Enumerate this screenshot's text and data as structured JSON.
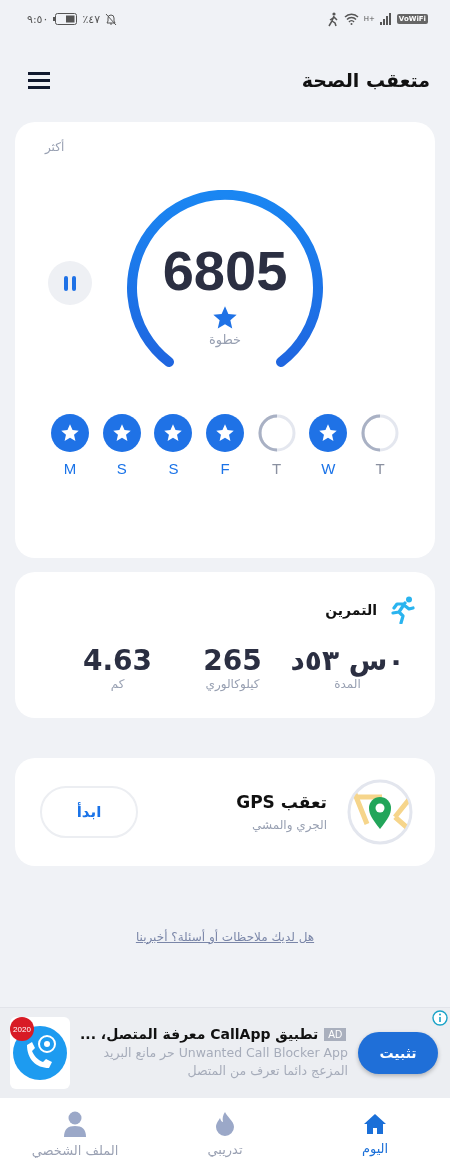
{
  "status_bar": {
    "time": "٩:٥٠",
    "battery": "٪٤٧",
    "network": "H+",
    "wifi_badge": "VoWiFi"
  },
  "header": {
    "title": "متعقب الصحة"
  },
  "steps_card": {
    "more": "أكثر",
    "steps": "6805",
    "unit": "خطوة",
    "days": [
      {
        "label": "T",
        "done": false
      },
      {
        "label": "W",
        "done": true
      },
      {
        "label": "T",
        "done": false
      },
      {
        "label": "F",
        "done": true
      },
      {
        "label": "S",
        "done": true
      },
      {
        "label": "S",
        "done": true
      },
      {
        "label": "M",
        "done": true
      }
    ]
  },
  "workout_card": {
    "title": "التمرين",
    "stats": [
      {
        "value": "٠س ٥٣د",
        "label": "المدة"
      },
      {
        "value": "265",
        "label": "كيلوكالوري"
      },
      {
        "value": "4.63",
        "label": "كم"
      }
    ]
  },
  "gps_card": {
    "title": "تعقب GPS",
    "subtitle": "الجري والمشي",
    "button": "ابدأ"
  },
  "feedback_link": "هل لديك ملاحظات أو أسئلة؟ أخبرينا",
  "ad": {
    "badge": "AD",
    "title": "تطبيق CallApp معرفة المتصل، ...",
    "description": "Unwanted Call Blocker App حر مانع البريد المزعج دائما تعرف من المتصل",
    "button": "تثبيت",
    "app_badge": "2020"
  },
  "bottom_nav": [
    {
      "kind": "home",
      "label": "اليوم",
      "selected": true
    },
    {
      "kind": "fire",
      "label": "تدريبي",
      "selected": false
    },
    {
      "kind": "person",
      "label": "الملف الشخصي",
      "selected": false
    }
  ]
}
